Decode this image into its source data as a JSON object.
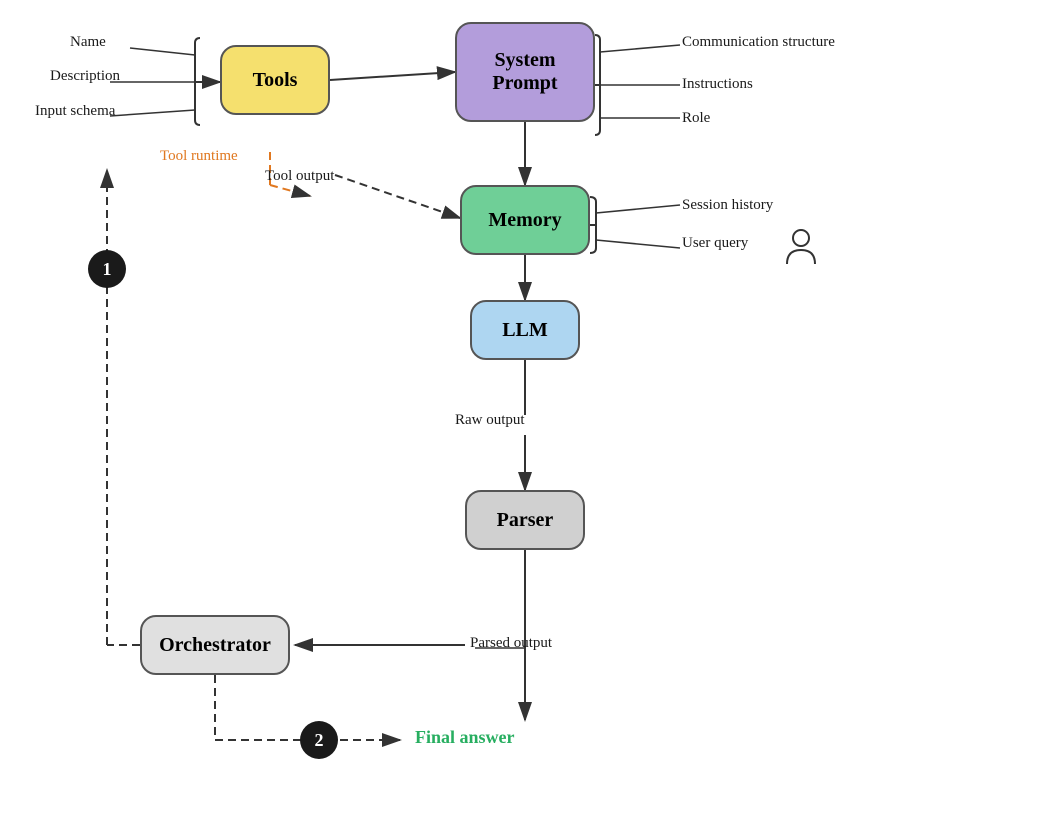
{
  "nodes": {
    "tools": {
      "label": "Tools"
    },
    "system_prompt": {
      "label": "System\nPrompt"
    },
    "memory": {
      "label": "Memory"
    },
    "llm": {
      "label": "LLM"
    },
    "parser": {
      "label": "Parser"
    },
    "orchestrator": {
      "label": "Orchestrator"
    }
  },
  "labels": {
    "name": "Name",
    "description": "Description",
    "input_schema": "Input schema",
    "tool_runtime": "Tool runtime",
    "communication_structure": "Communication structure",
    "instructions": "Instructions",
    "role": "Role",
    "tool_output": "Tool output",
    "session_history": "Session history",
    "user_query": "User query",
    "raw_output": "Raw output",
    "parsed_output": "Parsed output",
    "final_answer": "Final answer"
  },
  "badges": {
    "one": "1",
    "two": "2"
  }
}
